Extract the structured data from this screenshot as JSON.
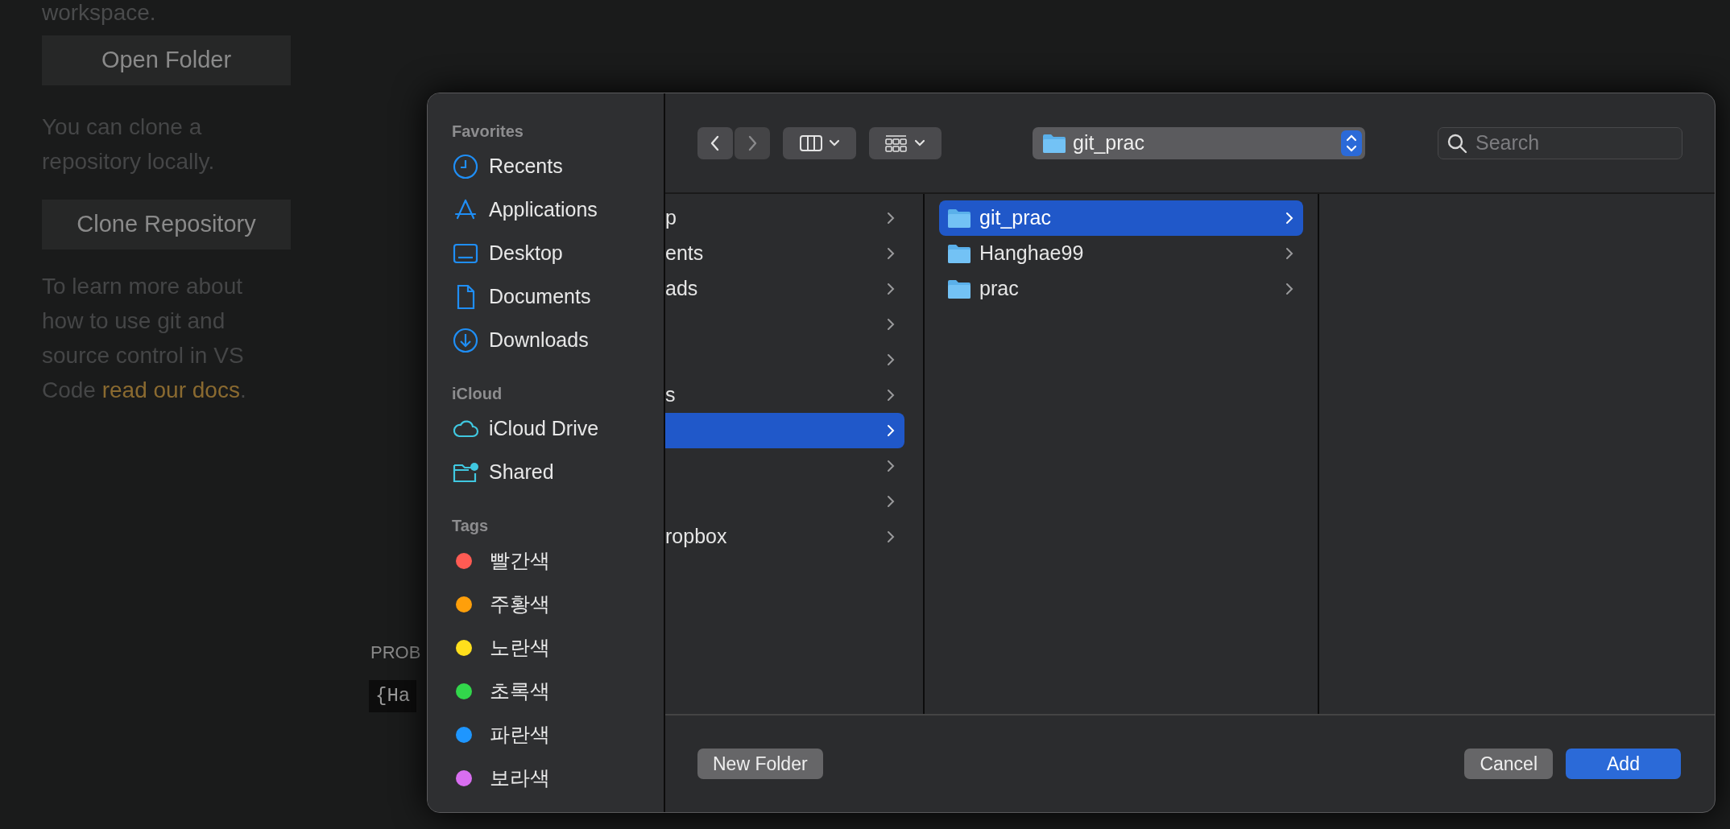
{
  "background": {
    "intro_tail": "workspace.",
    "buttons": [
      "Open Folder",
      "Clone Repository"
    ],
    "clone_text": "You can clone a repository locally.",
    "docs_text": "To learn more about how to use git and source control in VS Code ",
    "docs_link": "read our docs",
    "docs_after": ".",
    "panel_tab": "PROB",
    "terminal_text": "{Ha"
  },
  "dialog": {
    "sidebar": [
      {
        "title": "Favorites",
        "items": [
          {
            "label": "Recents",
            "kind": "clock"
          },
          {
            "label": "Applications",
            "kind": "apps"
          },
          {
            "label": "Desktop",
            "kind": "desktop"
          },
          {
            "label": "Documents",
            "kind": "document"
          },
          {
            "label": "Downloads",
            "kind": "download"
          }
        ]
      },
      {
        "title": "iCloud",
        "items": [
          {
            "label": "iCloud Drive",
            "kind": "cloud"
          },
          {
            "label": "Shared",
            "kind": "shared"
          }
        ]
      },
      {
        "title": "Tags",
        "items": [
          {
            "label": "빨간색",
            "kind": "tag",
            "color": "#ff5b53"
          },
          {
            "label": "주황색",
            "kind": "tag",
            "color": "#ff9f0a"
          },
          {
            "label": "노란색",
            "kind": "tag",
            "color": "#ffdf1c"
          },
          {
            "label": "초록색",
            "kind": "tag",
            "color": "#32d74b"
          },
          {
            "label": "파란색",
            "kind": "tag",
            "color": "#1e96ff"
          },
          {
            "label": "보라색",
            "kind": "tag",
            "color": "#d86ef0"
          }
        ]
      }
    ],
    "toolbar": {
      "nav": [
        {
          "kind": "back",
          "disabled": false
        },
        {
          "kind": "forward",
          "disabled": true
        }
      ],
      "path": "git_prac",
      "search": {
        "placeholder": "Search"
      }
    },
    "columns": [
      {
        "items": [
          {
            "label": "p",
            "selected": false
          },
          {
            "label": "ents",
            "selected": false
          },
          {
            "label": "ads",
            "selected": false
          },
          {
            "selected": false
          },
          {
            "selected": false
          },
          {
            "label": "s",
            "selected": false
          },
          {
            "selected": true
          },
          {
            "selected": false
          },
          {
            "selected": false
          },
          {
            "label": "ropbox",
            "selected": false
          }
        ]
      },
      {
        "items": [
          {
            "label": "git_prac",
            "selected": true,
            "kind": "folder"
          },
          {
            "label": "Hanghae99",
            "selected": false,
            "kind": "folder"
          },
          {
            "label": "prac",
            "selected": false,
            "kind": "folder"
          }
        ]
      }
    ],
    "footer": [
      {
        "label": "New Folder",
        "kind": "secondary"
      },
      {
        "label": "Cancel",
        "kind": "secondary"
      },
      {
        "label": "Add",
        "kind": "primary"
      }
    ]
  }
}
